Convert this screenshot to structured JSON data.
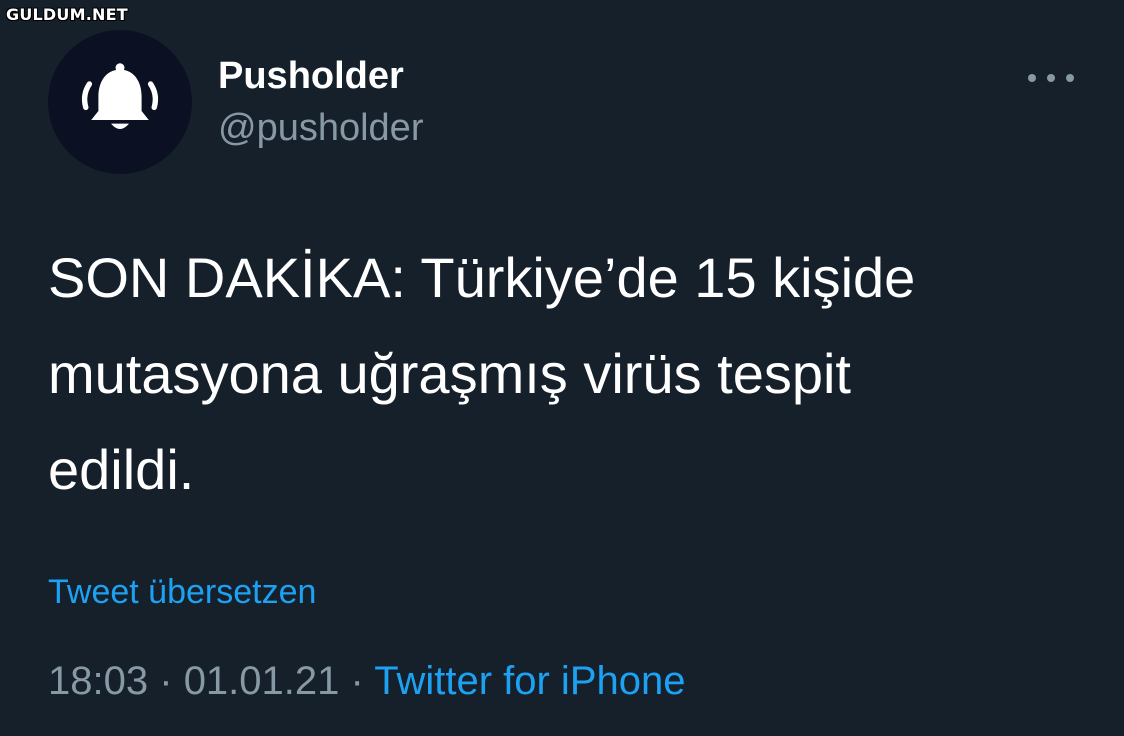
{
  "watermark": "GULDUM.NET",
  "tweet": {
    "avatar_icon": "bell-icon",
    "display_name": "Pusholder",
    "handle": "@pusholder",
    "more_icon": "more-options-icon",
    "text": "SON DAKİKA: Türkiye’de 15 kişide\nmutasyona uğraşmış virüs tespit\nedildi.",
    "translate_label": "Tweet übersetzen",
    "time": "18:03",
    "separator": "·",
    "date": "01.01.21",
    "source": "Twitter for iPhone"
  },
  "colors": {
    "background": "#15202b",
    "text": "#ffffff",
    "muted": "#8899a6",
    "link": "#1da1f2",
    "avatar_bg": "#0b1023"
  }
}
